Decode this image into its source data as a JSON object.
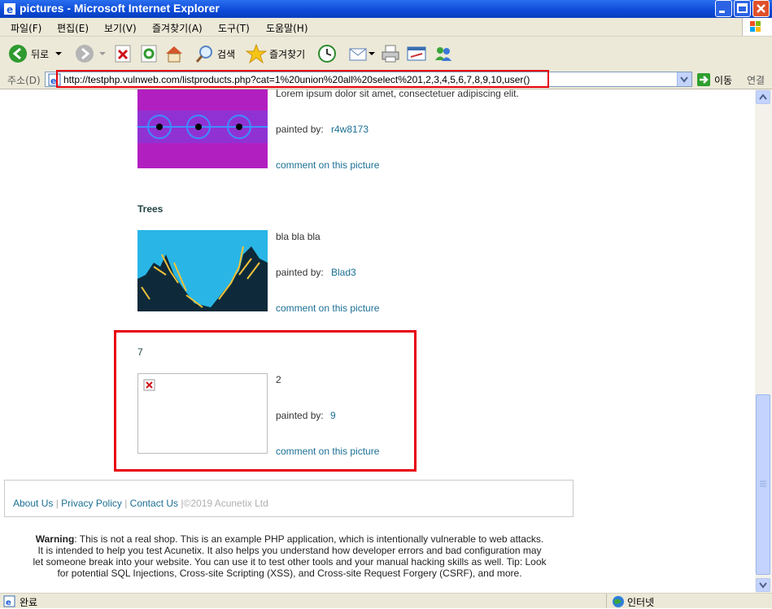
{
  "window": {
    "title": "pictures - Microsoft Internet Explorer"
  },
  "menu": {
    "items": [
      "파일(F)",
      "편집(E)",
      "보기(V)",
      "즐겨찾기(A)",
      "도구(T)",
      "도움말(H)"
    ]
  },
  "toolbar": {
    "back_label": "뒤로",
    "search_label": "검색",
    "favorites_label": "즐겨찾기"
  },
  "address": {
    "label": "주소(D)",
    "url": "http://testphp.vulnweb.com/listproducts.php?cat=1%20union%20all%20select%201,2,3,4,5,6,7,8,9,10,user()",
    "go_label": "이동",
    "links_label": "연결"
  },
  "products": [
    {
      "title": "",
      "description": "Lorem ipsum dolor sit amet, consectetuer adipiscing elit.",
      "painted_by_label": "painted by:",
      "artist": "r4w8173",
      "comment_link": "comment on this picture"
    },
    {
      "title": "Trees",
      "description": "bla bla bla",
      "painted_by_label": "painted by:",
      "artist": "Blad3",
      "comment_link": "comment on this picture"
    },
    {
      "title": "7",
      "description": "2",
      "painted_by_label": "painted by:",
      "artist": "9",
      "comment_link": "comment on this picture"
    }
  ],
  "footer": {
    "about": "About Us",
    "privacy": "Privacy Policy",
    "contact": "Contact Us",
    "separator": "|",
    "copyright": "©2019 Acunetix Ltd"
  },
  "warning": {
    "label": "Warning",
    "text": ": This is not a real shop. This is an example PHP application, which is intentionally vulnerable to web attacks. It is intended to help you test Acunetix. It also helps you understand how developer errors and bad configuration may let someone break into your website. You can use it to test other tools and your manual hacking skills as well. Tip: Look for potential SQL Injections, Cross-site Scripting (XSS), and Cross-site Request Forgery (CSRF), and more."
  },
  "status": {
    "left": "완료",
    "zone": "인터넷"
  },
  "colors": {
    "highlight": "#e8000b",
    "link": "#1b6f94"
  }
}
